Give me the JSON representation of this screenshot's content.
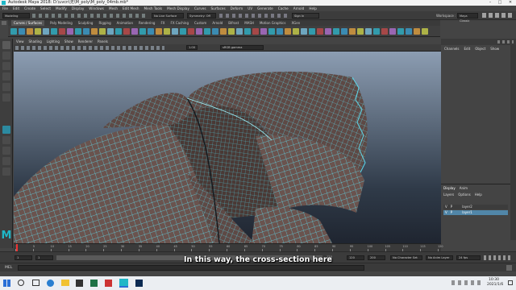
{
  "window": {
    "title": "Autodesk Maya 2018: D:\\uvcn\\无\\M_poly\\M_poly_04mb.mb*",
    "controls": [
      "–",
      "□",
      "✕"
    ]
  },
  "menubar": {
    "items": [
      "File",
      "Edit",
      "Create",
      "Select",
      "Modify",
      "Display",
      "Windows",
      "Mesh",
      "Edit Mesh",
      "Mesh Tools",
      "Mesh Display",
      "Curves",
      "Surfaces",
      "Deform",
      "UV",
      "Generate",
      "Cache",
      "Arnold",
      "Help"
    ]
  },
  "statusline": {
    "menuset": "Modeling",
    "live_surface": "No Live Surface",
    "symmetry": "Symmetry: Off",
    "signin": "Sign In",
    "workspace_label": "Workspace :",
    "workspace": "Maya Classic"
  },
  "shelf": {
    "tabs": [
      "Curves / Surfaces",
      "Poly Modeling",
      "Sculpting",
      "Rigging",
      "Animation",
      "Rendering",
      "FX",
      "FX Caching",
      "Custom",
      "Arnold",
      "Bifrost",
      "MASH",
      "Motion Graphics",
      "XGen"
    ],
    "active_index": 0
  },
  "panel": {
    "menu": [
      "View",
      "Shading",
      "Lighting",
      "Show",
      "Renderer",
      "Panels"
    ],
    "gamma_value": "1.00",
    "colorspace": "sRGB gamma"
  },
  "right": {
    "tabs": [
      "Channels",
      "Edit",
      "Object",
      "Show"
    ],
    "layer_tabs": [
      "Display",
      "Anim"
    ],
    "layer_menu": [
      "Layers",
      "Options",
      "Help"
    ],
    "layers": [
      {
        "v": "V",
        "p": "P",
        "name": "layer2"
      },
      {
        "v": "V",
        "p": "P",
        "name": "layer1"
      }
    ]
  },
  "timeline": {
    "ticks": [
      "1",
      "5",
      "10",
      "15",
      "20",
      "25",
      "30",
      "35",
      "40",
      "45",
      "50",
      "55",
      "60",
      "65",
      "70",
      "75",
      "80",
      "85",
      "90",
      "95",
      "100",
      "105",
      "110",
      "115",
      "120"
    ],
    "current": "1",
    "range_start": "1",
    "range_inner_start": "1",
    "range_end": "120",
    "end_a": "120",
    "end_b": "200",
    "fps": "24 fps",
    "char_set": "No Character Set",
    "anim_layer": "No Anim Layer"
  },
  "mel": {
    "label": "MEL"
  },
  "subtitle": "In this way, the cross-section here",
  "taskbar": {
    "time": "10:30",
    "date": "2021/1/6"
  },
  "colors": {
    "wire": "#5fd8ea",
    "mesh": "#6a534e",
    "viewport_top": "#8c9db2",
    "viewport_bottom": "#1f2530",
    "maya_logo": "#1fb7c7"
  }
}
